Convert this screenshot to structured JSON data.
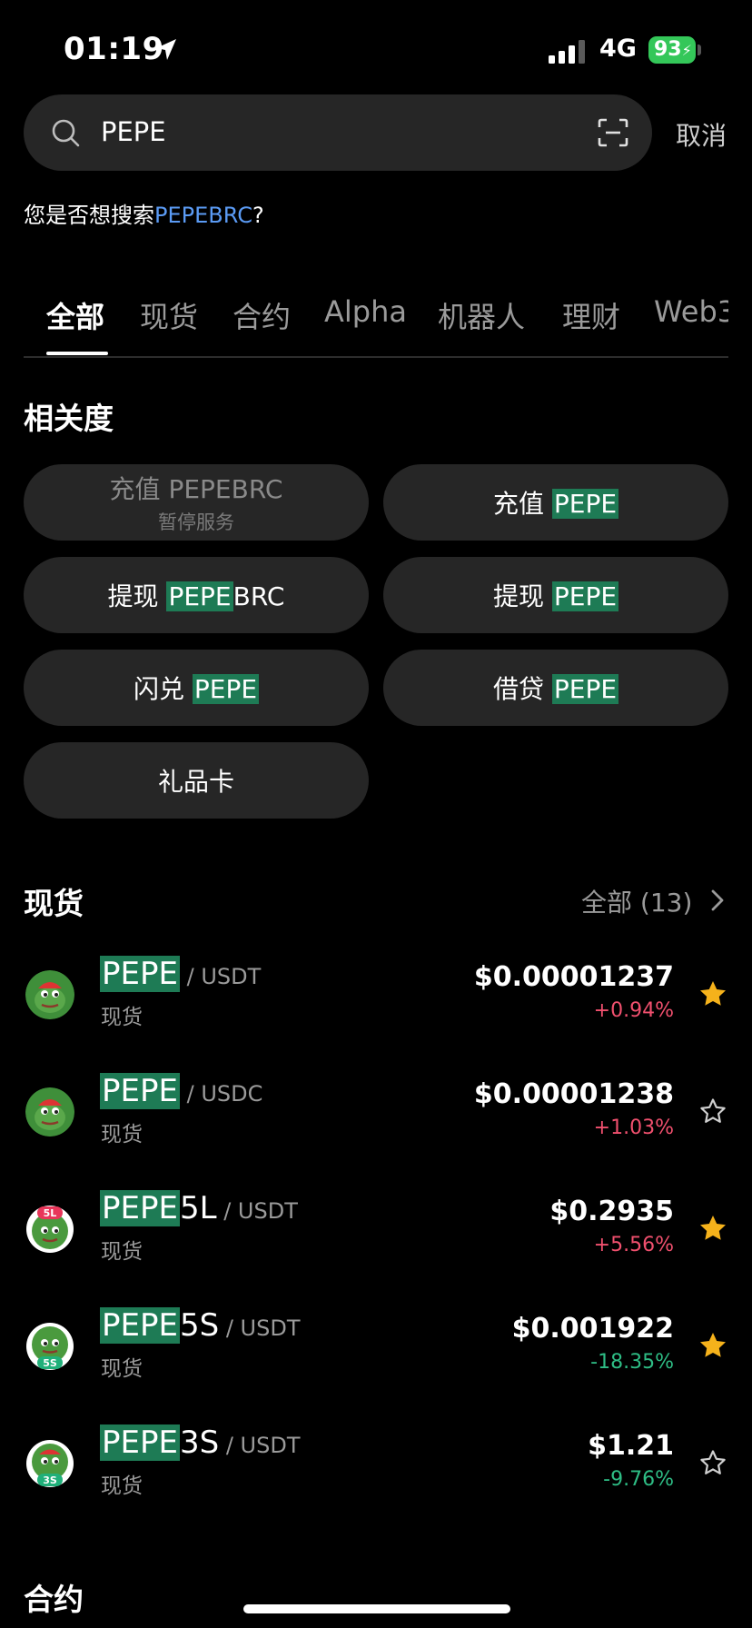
{
  "status_bar": {
    "time": "01:19",
    "network": "4G",
    "battery": "93"
  },
  "search": {
    "value": "PEPE",
    "cancel_label": "取消"
  },
  "suggestion": {
    "prefix": "您是否想搜索",
    "term": "PEPEBRC",
    "suffix": "?"
  },
  "tabs": [
    {
      "label": "全部",
      "active": true
    },
    {
      "label": "现货"
    },
    {
      "label": "合约"
    },
    {
      "label": "Alpha"
    },
    {
      "label": "机器人"
    },
    {
      "label": "理财"
    },
    {
      "label": "Web3"
    }
  ],
  "relevance": {
    "title": "相关度",
    "actions": [
      {
        "label": "充值",
        "token": "PEPEBRC",
        "sub": "暂停服务",
        "disabled": true
      },
      {
        "label": "充值",
        "token_hl": "PEPE",
        "token_rest": ""
      },
      {
        "label": "提现",
        "token_hl": "PEPE",
        "token_rest": "BRC"
      },
      {
        "label": "提现",
        "token_hl": "PEPE",
        "token_rest": ""
      },
      {
        "label": "闪兑",
        "token_hl": "PEPE",
        "token_rest": ""
      },
      {
        "label": "借贷",
        "token_hl": "PEPE",
        "token_rest": ""
      },
      {
        "label": "礼品卡"
      }
    ]
  },
  "spot": {
    "title": "现货",
    "see_all": "全部 (13)",
    "rows": [
      {
        "base_hl": "PEPE",
        "base_rest": "",
        "quote": " / USDT",
        "market": "现货",
        "price": "$0.00001237",
        "change": "+0.94%",
        "direction": "up",
        "favorite": true,
        "badge": ""
      },
      {
        "base_hl": "PEPE",
        "base_rest": "",
        "quote": " / USDC",
        "market": "现货",
        "price": "$0.00001238",
        "change": "+1.03%",
        "direction": "up",
        "favorite": false,
        "badge": ""
      },
      {
        "base_hl": "PEPE",
        "base_rest": "5L",
        "quote": " / USDT",
        "market": "现货",
        "price": "$0.2935",
        "change": "+5.56%",
        "direction": "up",
        "favorite": true,
        "badge": "5L"
      },
      {
        "base_hl": "PEPE",
        "base_rest": "5S",
        "quote": " / USDT",
        "market": "现货",
        "price": "$0.001922",
        "change": "-18.35%",
        "direction": "down",
        "favorite": true,
        "badge": "5S"
      },
      {
        "base_hl": "PEPE",
        "base_rest": "3S",
        "quote": " / USDT",
        "market": "现货",
        "price": "$1.21",
        "change": "-9.76%",
        "direction": "down",
        "favorite": false,
        "badge": "3S"
      }
    ]
  },
  "futures": {
    "title": "合约"
  },
  "colors": {
    "accent_green": "#1e7b55",
    "up": "#f0506e",
    "down": "#2ebd85",
    "star": "#f5b21b",
    "link": "#5b9bf5"
  }
}
